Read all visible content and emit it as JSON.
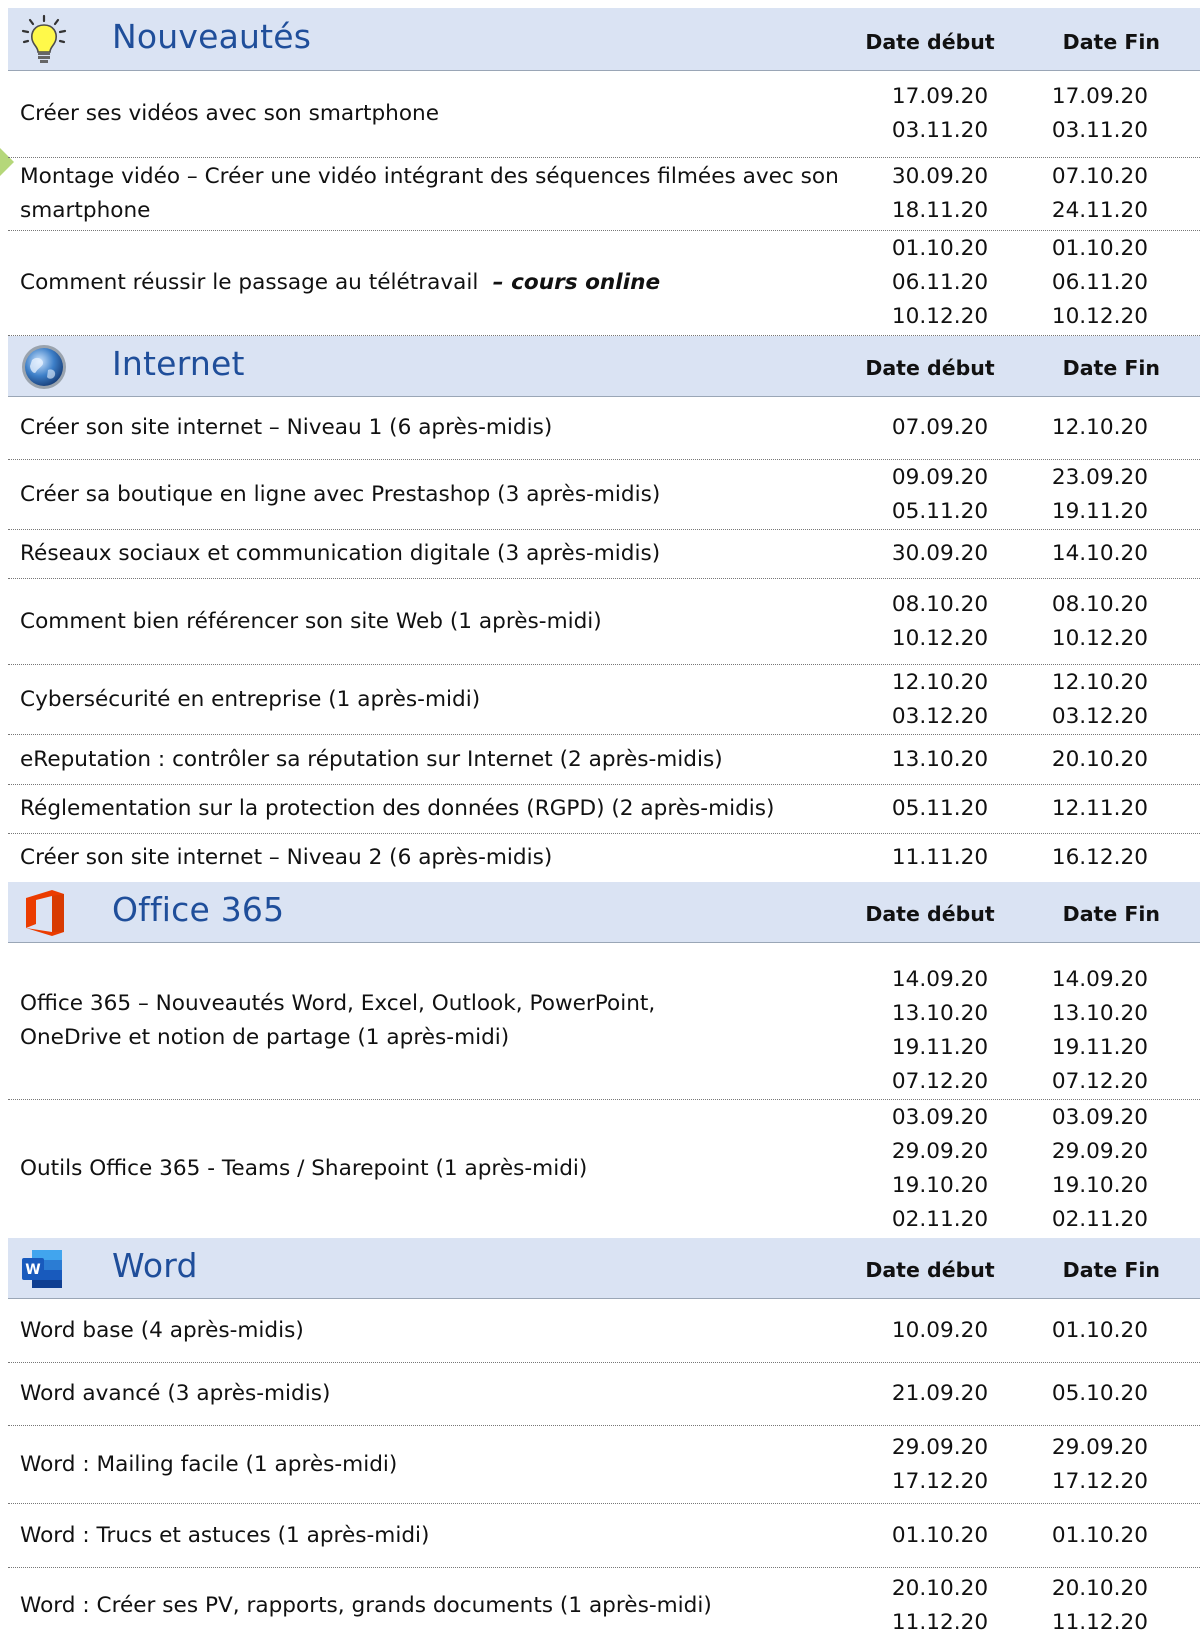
{
  "colors": {
    "header_bg": "#dae3f3",
    "title": "#1f4e9a"
  },
  "sections": [
    {
      "title": "Nouveautés",
      "icon": "lightbulb-icon",
      "col_start": "Date début",
      "col_end": "Date Fin",
      "rows": [
        {
          "label": "Créer ses vidéos avec son smartphone",
          "starts": [
            "17.09.20",
            "03.11.20"
          ],
          "ends": [
            "17.09.20",
            "03.11.20"
          ]
        },
        {
          "label": "Montage vidéo – Créer une vidéo intégrant des séquences filmées avec son smartphone",
          "starts": [
            "30.09.20",
            "18.11.20"
          ],
          "ends": [
            "07.10.20",
            "24.11.20"
          ]
        },
        {
          "label": "Comment réussir le passage au télétravail ",
          "emph": " – cours online",
          "starts": [
            "01.10.20",
            "06.11.20",
            "10.12.20"
          ],
          "ends": [
            "01.10.20",
            "06.11.20",
            "10.12.20"
          ]
        }
      ]
    },
    {
      "title": "Internet",
      "icon": "globe-icon",
      "col_start": "Date début",
      "col_end": "Date Fin",
      "rows": [
        {
          "label": "Créer son site internet – Niveau 1 (6 après-midis)",
          "starts": [
            "07.09.20"
          ],
          "ends": [
            "12.10.20"
          ]
        },
        {
          "label": "Créer sa boutique en ligne avec Prestashop (3 après-midis)",
          "starts": [
            "09.09.20",
            "05.11.20"
          ],
          "ends": [
            "23.09.20",
            "19.11.20"
          ]
        },
        {
          "label": "Réseaux sociaux et communication digitale (3 après-midis)",
          "starts": [
            "30.09.20"
          ],
          "ends": [
            "14.10.20"
          ]
        },
        {
          "label": "Comment bien référencer son site Web (1 après-midi)",
          "starts": [
            "08.10.20",
            "10.12.20"
          ],
          "ends": [
            "08.10.20",
            "10.12.20"
          ]
        },
        {
          "label": "Cybersécurité en entreprise (1 après-midi)",
          "starts": [
            "12.10.20",
            "03.12.20"
          ],
          "ends": [
            "12.10.20",
            "03.12.20"
          ]
        },
        {
          "label": "eReputation : contrôler sa réputation sur Internet (2 après-midis)",
          "starts": [
            "13.10.20"
          ],
          "ends": [
            "20.10.20"
          ]
        },
        {
          "label": "Réglementation sur la protection des données (RGPD) (2 après-midis)",
          "starts": [
            "05.11.20"
          ],
          "ends": [
            "12.11.20"
          ]
        },
        {
          "label": "Créer son site internet – Niveau 2 (6 après-midis)",
          "starts": [
            "11.11.20"
          ],
          "ends": [
            "16.12.20"
          ]
        }
      ]
    },
    {
      "title": "Office 365",
      "icon": "office-365-icon",
      "col_start": "Date début",
      "col_end": "Date Fin",
      "rows": [
        {
          "label": "Office 365 – Nouveautés Word, Excel, Outlook, PowerPoint, OneDrive et notion de partage (1 après-midi)",
          "starts": [
            "14.09.20",
            "13.10.20",
            "19.11.20",
            "07.12.20"
          ],
          "ends": [
            "14.09.20",
            "13.10.20",
            "19.11.20",
            "07.12.20"
          ]
        },
        {
          "label": "Outils Office 365 - Teams / Sharepoint (1 après-midi)",
          "starts": [
            "03.09.20",
            "29.09.20",
            "19.10.20",
            "02.11.20"
          ],
          "ends": [
            "03.09.20",
            "29.09.20",
            "19.10.20",
            "02.11.20"
          ]
        }
      ]
    },
    {
      "title": "Word",
      "icon": "word-icon",
      "col_start": "Date début",
      "col_end": "Date Fin",
      "rows": [
        {
          "label": "Word base (4 après-midis)",
          "starts": [
            "10.09.20"
          ],
          "ends": [
            "01.10.20"
          ]
        },
        {
          "label": "Word avancé (3 après-midis)",
          "starts": [
            "21.09.20"
          ],
          "ends": [
            "05.10.20"
          ]
        },
        {
          "label": "Word : Mailing facile (1 après-midi)",
          "starts": [
            "29.09.20",
            "17.12.20"
          ],
          "ends": [
            "29.09.20",
            "17.12.20"
          ]
        },
        {
          "label": "Word : Trucs et astuces (1 après-midi)",
          "starts": [
            "01.10.20"
          ],
          "ends": [
            "01.10.20"
          ]
        },
        {
          "label": "Word : Créer ses PV, rapports, grands documents (1 après-midi)",
          "starts": [
            "20.10.20",
            "11.12.20"
          ],
          "ends": [
            "20.10.20",
            "11.12.20"
          ]
        }
      ]
    }
  ]
}
